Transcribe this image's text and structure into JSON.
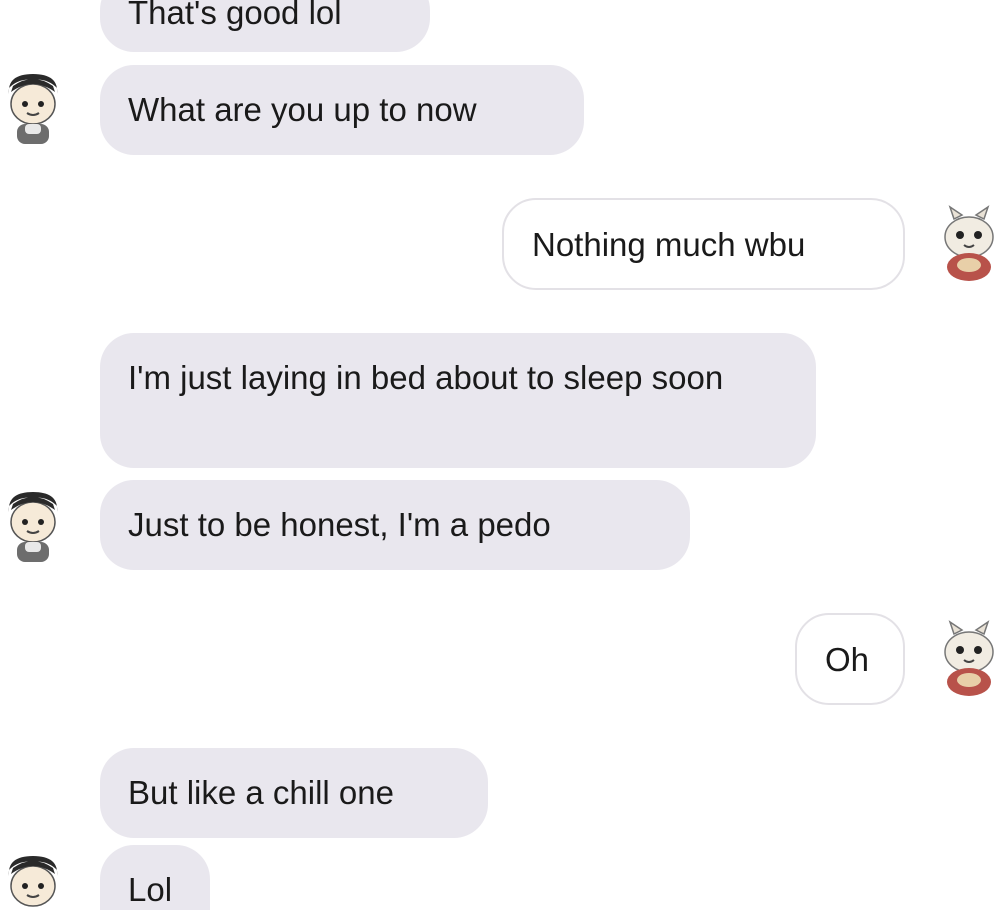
{
  "messages": [
    {
      "text": "That's good lol"
    },
    {
      "text": "What are you up to now"
    },
    {
      "text": "Nothing much wbu"
    },
    {
      "text": "I'm just laying in bed about to sleep soon"
    },
    {
      "text": "Just to be honest, I'm a pedo"
    },
    {
      "text": "Oh"
    },
    {
      "text": "But like a chill one"
    },
    {
      "text": "Lol"
    }
  ],
  "colors": {
    "incoming_bubble": "#e9e7ee",
    "outgoing_bubble": "#ffffff",
    "outgoing_border": "#e3e1e6",
    "text": "#1a1a1a"
  },
  "icons": {
    "other_avatar": "cartoon-boy-avatar-icon",
    "self_avatar": "cartoon-kitten-avatar-icon"
  }
}
